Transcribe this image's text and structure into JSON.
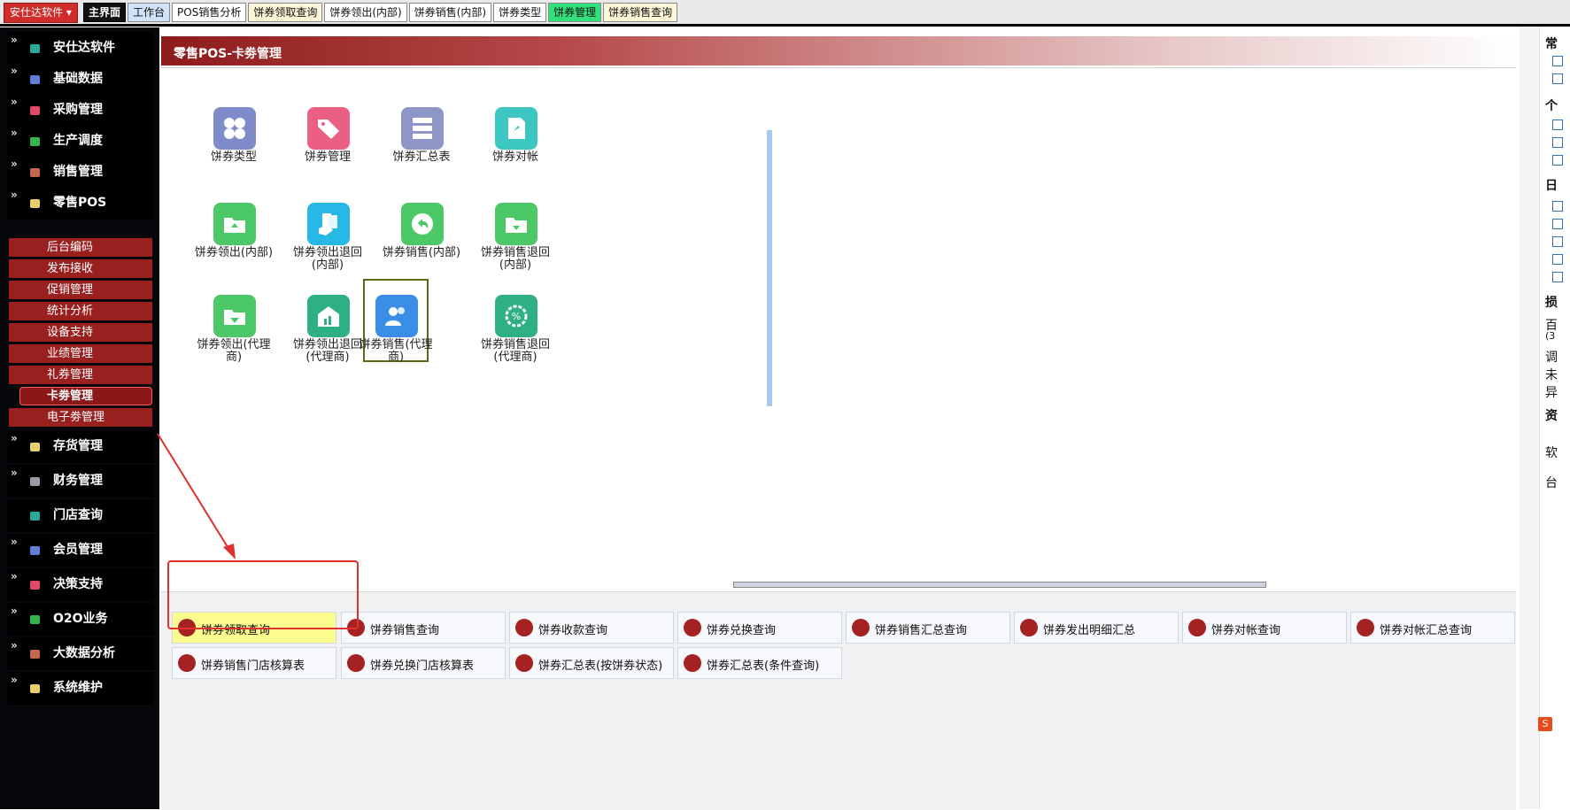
{
  "top": {
    "app_menu": "安仕达软件",
    "tabs": [
      {
        "label": "主界面"
      },
      {
        "label": "工作台"
      },
      {
        "label": "POS销售分析"
      },
      {
        "label": "饼券领取查询"
      },
      {
        "label": "饼券领出(内部)"
      },
      {
        "label": "饼券销售(内部)"
      },
      {
        "label": "饼券类型"
      },
      {
        "label": "饼券管理"
      },
      {
        "label": "饼券销售查询"
      }
    ]
  },
  "sidebar": {
    "items": [
      {
        "label": "安仕达软件",
        "color": "#2aa89a"
      },
      {
        "label": "基础数据",
        "color": "#5f7fd6"
      },
      {
        "label": "采购管理",
        "color": "#e34a6a"
      },
      {
        "label": "生产调度",
        "color": "#36b34a"
      },
      {
        "label": "销售管理",
        "color": "#c26a4a"
      },
      {
        "label": "零售POS",
        "color": "#e8d06a"
      },
      {
        "label": "存货管理",
        "color": "#e8d06a"
      },
      {
        "label": "财务管理",
        "color": "#9a9aa8"
      },
      {
        "label": "门店查询",
        "color": "#2aa89a"
      },
      {
        "label": "会员管理",
        "color": "#5f7fd6"
      },
      {
        "label": "决策支持",
        "color": "#e34a6a"
      },
      {
        "label": "O2O业务",
        "color": "#36b34a"
      },
      {
        "label": "大数据分析",
        "color": "#c26a4a"
      },
      {
        "label": "系统维护",
        "color": "#e8d06a"
      }
    ],
    "sub_items": [
      "后台编码",
      "发布接收",
      "促销管理",
      "统计分析",
      "设备支持",
      "业绩管理",
      "礼券管理",
      "卡劵管理",
      "电子劵管理"
    ],
    "selected_sub": "卡劵管理"
  },
  "main": {
    "title": "零售POS-卡劵管理",
    "icons": [
      {
        "label": "饼券类型",
        "color": "#7f8cc9",
        "icon": "four-petal-icon"
      },
      {
        "label": "饼券管理",
        "color": "#ec5f84",
        "icon": "tags-icon"
      },
      {
        "label": "饼券汇总表",
        "color": "#8e95c7",
        "icon": "server-stack-icon"
      },
      {
        "label": "饼券对帐",
        "color": "#3cc7c3",
        "icon": "pin-doc-icon"
      },
      {
        "label": "饼券领出(内部)",
        "color": "#4dc866",
        "icon": "folder-upload-icon"
      },
      {
        "label": "饼券领出退回(内部)",
        "color": "#28b8e6",
        "icon": "cards-hand-icon"
      },
      {
        "label": "饼券销售(内部)",
        "color": "#4dc866",
        "icon": "undo-circle-icon"
      },
      {
        "label": "饼券销售退回(内部)",
        "color": "#4dc866",
        "icon": "folder-download-icon"
      },
      {
        "label": "饼券领出(代理商)",
        "color": "#4dc866",
        "icon": "folder-down-arrow-icon"
      },
      {
        "label": "饼券领出退回(代理商)",
        "color": "#2fb082",
        "icon": "building-chart-icon"
      },
      {
        "label": "饼券销售(代理商)",
        "color": "#3a8ee6",
        "icon": "users-icon"
      },
      {
        "label": "饼券销售退回(代理商)",
        "color": "#2fb082",
        "icon": "percent-gear-icon"
      }
    ],
    "queries": [
      {
        "label": "饼券领取查询",
        "icon": "tag-icon"
      },
      {
        "label": "饼券销售查询",
        "icon": "gift-icon"
      },
      {
        "label": "饼券收款查询",
        "icon": "search-icon"
      },
      {
        "label": "饼券兑换查询",
        "icon": "dollar-icon"
      },
      {
        "label": "饼券销售汇总查询",
        "icon": "layers-icon"
      },
      {
        "label": "饼券发出明细汇总",
        "icon": "contact-card-icon"
      },
      {
        "label": "饼券对帐查询",
        "icon": "send-icon"
      },
      {
        "label": "饼券对帐汇总查询",
        "icon": "search-icon"
      },
      {
        "label": "饼券销售门店核算表",
        "icon": "user-icon"
      },
      {
        "label": "饼券兑换门店核算表",
        "icon": "tag-icon"
      },
      {
        "label": "饼券汇总表(按饼券状态)",
        "icon": "pie-icon"
      },
      {
        "label": "饼券汇总表(条件查询)",
        "icon": "pie-icon"
      }
    ]
  },
  "right": {
    "chars": [
      "常",
      "个",
      "日",
      "损",
      "百",
      "(3",
      "调",
      "未",
      "异",
      "资",
      "软",
      "台"
    ]
  },
  "colors": {
    "accent_red": "#9a2020",
    "active_tab": "#32e07c"
  }
}
